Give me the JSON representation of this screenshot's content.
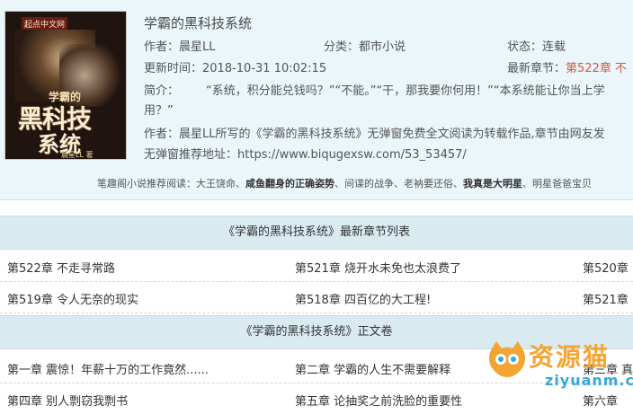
{
  "book": {
    "title": "学霸的黑科技系统",
    "author_label": "作者：",
    "author": "晨星LL",
    "category_label": "分类：",
    "category": "都市小说",
    "status_label": "状态：",
    "status": "连载",
    "updated_label": "更新时间：",
    "updated": "2018-10-31 10:02:15",
    "latest_label": "最新章节：",
    "latest": "第522章 不",
    "intro_label": "简介：",
    "intro_line1": "“系统，积分能兑钱吗？”“不能。”“干，那我要你何用！”“本系统能让你当上学",
    "intro_line2": "用？”",
    "desc_line": "作者：晨星LL所写的《学霸的黑科技系统》无弹窗免费全文阅读为转载作品,章节由网友发",
    "url_label": "无弹窗推荐地址：",
    "url": "https://www.biqugexsw.com/53_53457/"
  },
  "cover": {
    "publisher": "起点中文网",
    "small_text": "学霸的",
    "big_text1": "黑科技",
    "big_text2": "系统",
    "author_text": "晨星LL 著"
  },
  "recommend": {
    "label": "笔趣阁小说推荐阅读：",
    "items": [
      "大王饶命、",
      "咸鱼翻身的正确姿势",
      "、",
      "间谍的战争、",
      "老衲要还俗、",
      "我真是大明星",
      "、",
      "明星爸爸宝贝"
    ]
  },
  "latest_section": {
    "heading": "《学霸的黑科技系统》最新章节列表",
    "rows": [
      [
        "第522章 不走寻常路",
        "第521章 烧开水未免也太浪费了",
        "第520章"
      ],
      [
        "第519章 令人无奈的现实",
        "第518章 四百亿的大工程!",
        "第521章"
      ]
    ]
  },
  "main_section": {
    "heading": "《学霸的黑科技系统》正文卷",
    "rows": [
      [
        "第一章 震惊！年薪十万的工作竟然......",
        "第二章 学霸的人生不需要解释",
        "第三章 真"
      ],
      [
        "第四章 别人剽窃我剽书",
        "第五章 论抽奖之前洗脸的重要性",
        "第六章"
      ]
    ]
  },
  "watermark": {
    "brand": "资源猫",
    "url": "ziyuanm.com"
  }
}
